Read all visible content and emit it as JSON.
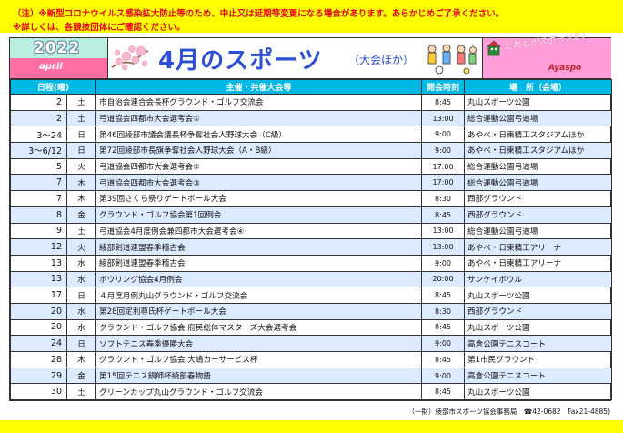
{
  "notice": {
    "line1": "（注）※新型コロナウイルス感染拡大防止等のため、中止又は延期等変更になる場合があります。あらかじめご了承ください。",
    "line2": "※詳しくは、各競技団体にご確認ください。"
  },
  "header": {
    "year": "2022",
    "month_word": "april",
    "title": "4月のスポーツ",
    "subtitle": "（大会ほか）",
    "slogan": "たれもがスポーツを！",
    "brand": "Ayaspo"
  },
  "table": {
    "columns": [
      "日程(曜)",
      "",
      "主催・共催大会等",
      "開会時刻",
      "場　所（会場）"
    ],
    "rows": [
      {
        "date": "2",
        "dow": "土",
        "event": "市自治会連合会長杯グラウンド・ゴルフ交流会",
        "time": "8:45",
        "venue": "丸山スポーツ公園"
      },
      {
        "date": "2",
        "dow": "土",
        "event": "弓道協会四都市大会選考会①",
        "time": "13:00",
        "venue": "総合運動公園弓道場"
      },
      {
        "date": "3～24",
        "dow": "日",
        "event": "第46回綾部市議会議長杯争奪社会人野球大会（C級）",
        "time": "9:00",
        "venue": "あやべ・日東精工スタジアムほか"
      },
      {
        "date": "3～6/12",
        "dow": "日",
        "event": "第72回綾部市長旗争奪社会人野球大会（A・B級）",
        "time": "9:00",
        "venue": "あやべ・日東精工スタジアムほか"
      },
      {
        "date": "5",
        "dow": "火",
        "event": "弓道協会四都市大会選考会②",
        "time": "17:00",
        "venue": "総合運動公園弓道場"
      },
      {
        "date": "7",
        "dow": "木",
        "event": "弓道協会四都市大会選考会③",
        "time": "17:00",
        "venue": "総合運動公園弓道場"
      },
      {
        "date": "7",
        "dow": "木",
        "event": "第39回さくら祭りゲートボール大会",
        "time": "8:30",
        "venue": "西部グラウンド"
      },
      {
        "date": "8",
        "dow": "金",
        "event": "グラウンド・ゴルフ協会第1回例会",
        "time": "8:45",
        "venue": "西部グラウンド"
      },
      {
        "date": "9",
        "dow": "土",
        "event": "弓道協会4月度例会兼四都市大会選考会④",
        "time": "13:00",
        "venue": "総合運動公園弓道場"
      },
      {
        "date": "12",
        "dow": "火",
        "event": "綾部剣道連盟春季稽古会",
        "time": "13:00",
        "venue": "あやべ・日東精工アリーナ"
      },
      {
        "date": "13",
        "dow": "水",
        "event": "綾部剣道連盟春季稽古会",
        "time": "9:00",
        "venue": "あやべ・日東精工アリーナ"
      },
      {
        "date": "13",
        "dow": "水",
        "event": "ボウリング協会4月例会",
        "time": "20:00",
        "venue": "サンケイボウル"
      },
      {
        "date": "17",
        "dow": "日",
        "event": "４月度月例丸山グラウンド・ゴルフ交流会",
        "time": "8:45",
        "venue": "丸山スポーツ公園"
      },
      {
        "date": "20",
        "dow": "水",
        "event": "第28回定利尊氏杯ゲートボール大会",
        "time": "8:30",
        "venue": "西部グラウンド"
      },
      {
        "date": "20",
        "dow": "水",
        "event": "グラウンド・ゴルフ協会 府民総体マスターズ大会選考会",
        "time": "8:45",
        "venue": "丸山スポーツ公園"
      },
      {
        "date": "24",
        "dow": "日",
        "event": "ソフトテニス春季優勝大会",
        "time": "9:00",
        "venue": "高倉公園テニスコート"
      },
      {
        "date": "28",
        "dow": "木",
        "event": "グラウンド・ゴルフ協会 大嶋カーサービス杯",
        "time": "8:45",
        "venue": "第1市民グラウンド"
      },
      {
        "date": "29",
        "dow": "金",
        "event": "第15回テニス鍋師杯綾部春物語",
        "time": "9:00",
        "venue": "高倉公園テニスコート"
      },
      {
        "date": "30",
        "dow": "土",
        "event": "グリーンカップ丸山グラウンド・ゴルフ交流会",
        "time": "8:45",
        "venue": "丸山スポーツ公園"
      }
    ]
  },
  "footer": {
    "contact": "（一財）綾部市スポーツ協会事務局　☎42-0682　Fax21-4885)"
  },
  "colors": {
    "notice_bg": "#ffff00",
    "notice_text": "#e8001c",
    "header_blue": "#00b8e6",
    "row_blue": "#dcebff",
    "title_blue": "#2b4fd6",
    "pink": "#ff6ea4"
  }
}
